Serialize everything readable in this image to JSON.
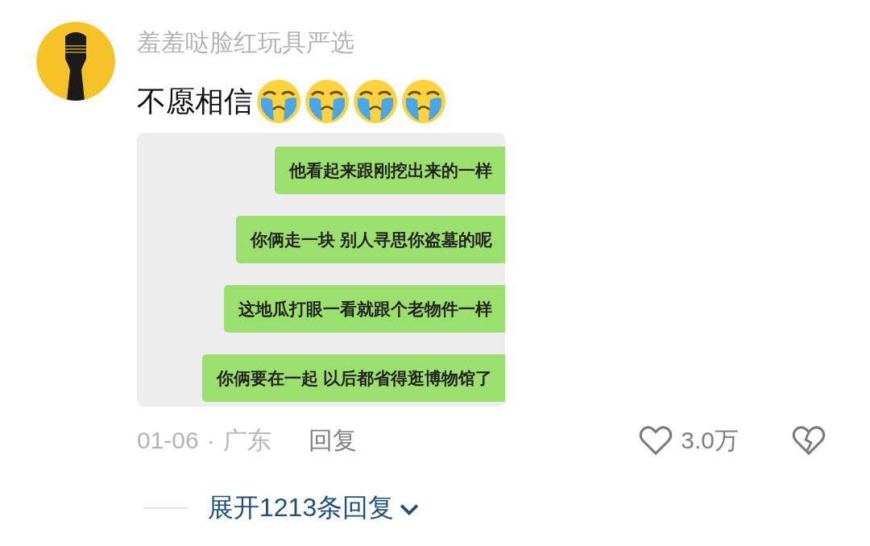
{
  "comment": {
    "author": "羞羞哒脸红玩具严选",
    "text": "不愿相信",
    "emojis": [
      {
        "kind": "crying"
      },
      {
        "kind": "crying"
      },
      {
        "kind": "crying"
      },
      {
        "kind": "crying"
      }
    ],
    "attachment": {
      "kind": "chat-screenshot",
      "messages": [
        {
          "text": "他看起来跟刚挖出来的一样"
        },
        {
          "text": "你俩走一块 别人寻思你盗墓的呢"
        },
        {
          "text": "这地瓜打眼一看就跟个老物件一样"
        },
        {
          "text": "你俩要在一起 以后都省得逛博物馆了"
        }
      ]
    },
    "date": "01-06",
    "separator": "·",
    "location": "广东",
    "reply": "回复",
    "likes": "3.0万",
    "liked": false,
    "disliked": false
  },
  "expand": {
    "label": "展开1213条回复"
  }
}
